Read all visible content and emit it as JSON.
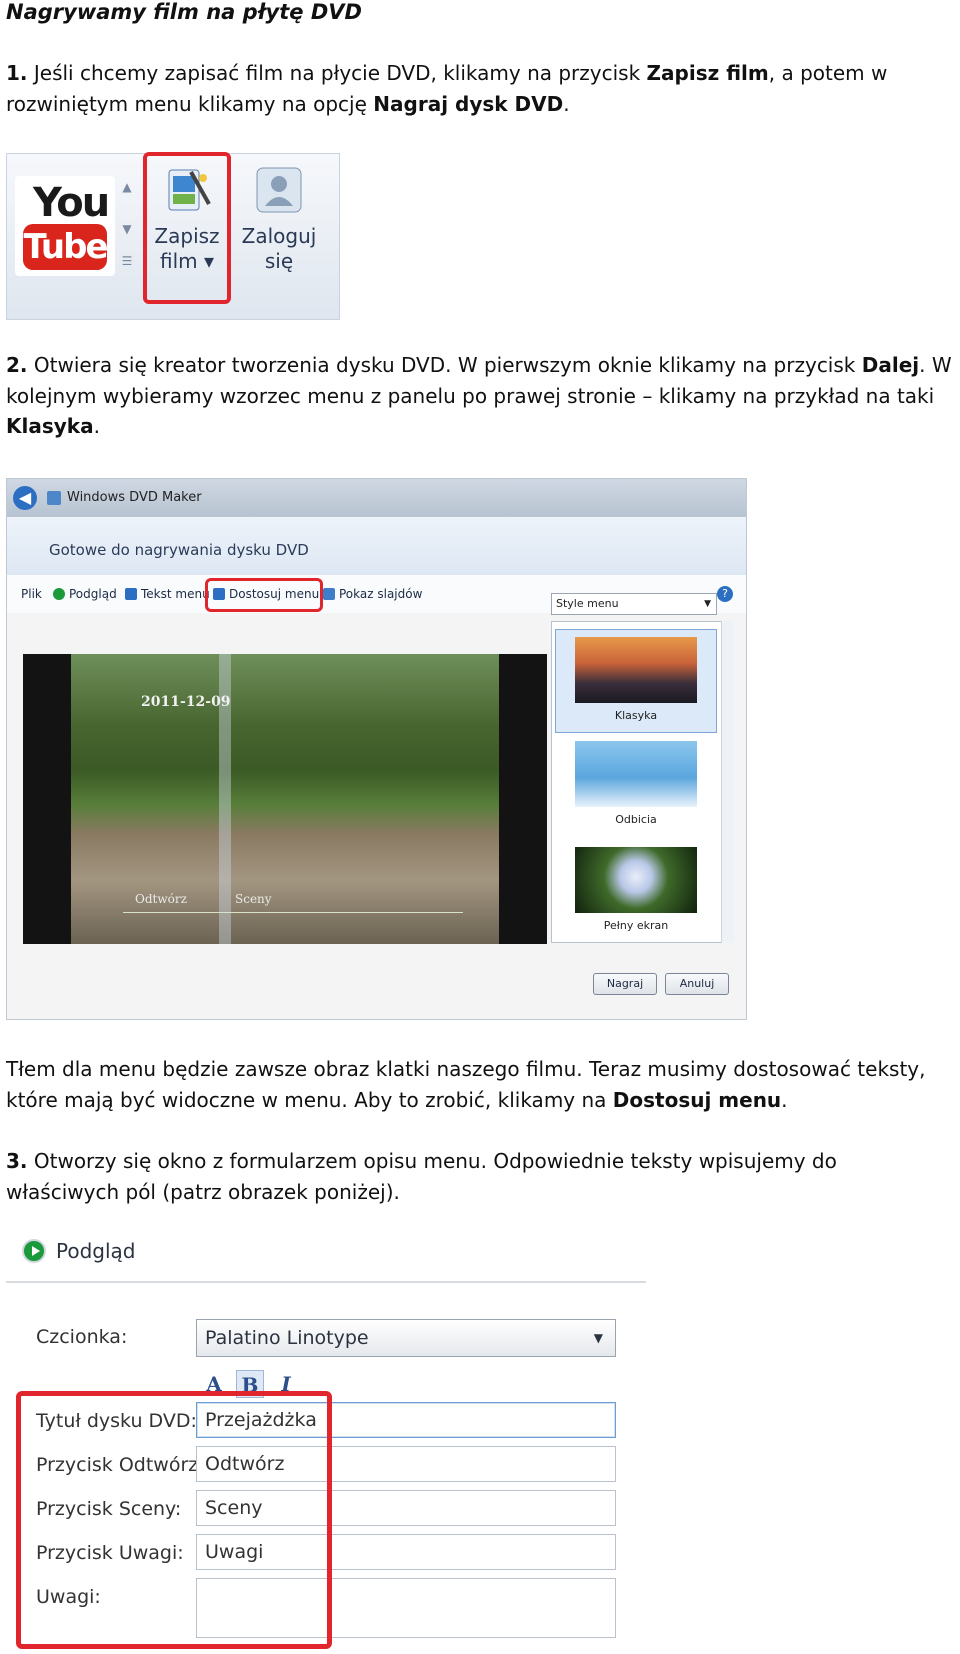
{
  "heading": "Nagrywamy film na płytę DVD",
  "step1": {
    "num": "1.",
    "t1": " Jeśli chcemy zapisać film na płycie DVD, klikamy na przycisk ",
    "b1": "Zapisz film",
    "t2": ", a potem w rozwiniętym menu klikamy na opcję ",
    "b2": "Nagraj dysk DVD",
    "t3": "."
  },
  "ribbon": {
    "logo_you": "You",
    "logo_tube": "Tube",
    "save_label_1": "Zapisz",
    "save_label_2": "film ▾",
    "login_label_1": "Zaloguj",
    "login_label_2": "się"
  },
  "step2": {
    "num": "2.",
    "t1": " Otwiera się kreator tworzenia dysku DVD. W pierwszym oknie klikamy na przycisk ",
    "b1": "Dalej",
    "t2": ". W kolejnym wybieramy wzorzec menu z panelu po prawej stronie – klikamy na przykład na taki ",
    "b2": "Klasyka",
    "t3": "."
  },
  "dvd_maker": {
    "app_title": "Windows DVD Maker",
    "heading": "Gotowe do nagrywania dysku DVD",
    "toolbar": [
      "Plik",
      "Podgląd",
      "Tekst menu",
      "Dostosuj menu",
      "Pokaz slajdów"
    ],
    "help": "?",
    "preview_date": "2011-12-09",
    "preview_play": "Odtwórz",
    "preview_scenes": "Sceny",
    "style_dropdown": "Style menu",
    "styles": [
      "Klasyka",
      "Odbicia",
      "Pełny ekran"
    ],
    "burn_button": "Nagraj",
    "cancel_button": "Anuluj"
  },
  "para3": {
    "t1": "Tłem dla menu będzie zawsze obraz klatki naszego filmu. Teraz musimy dostosować teksty, które mają być widoczne w menu. Aby to zrobić, klikamy na ",
    "b1": "Dostosuj menu",
    "t2": "."
  },
  "step3": {
    "num": "3.",
    "t1": " Otworzy się okno z formularzem opisu menu. Odpowiednie teksty wpisujemy do właściwych pól (patrz obrazek poniżej)."
  },
  "form": {
    "preview_label": "Podgląd",
    "font_label": "Czcionka:",
    "font_value": "Palatino Linotype",
    "fmt_a": "A",
    "fmt_b": "B",
    "fmt_i": "I",
    "fields": [
      {
        "label": "Tytuł dysku DVD:",
        "value": "Przejażdżka"
      },
      {
        "label": "Przycisk Odtwórz:",
        "value": "Odtwórz"
      },
      {
        "label": "Przycisk Sceny:",
        "value": "Sceny"
      },
      {
        "label": "Przycisk Uwagi:",
        "value": "Uwagi"
      },
      {
        "label": "Uwagi:",
        "value": ""
      }
    ]
  },
  "colors": {
    "highlight": "#e0262c",
    "accent": "#2c6fc2"
  }
}
